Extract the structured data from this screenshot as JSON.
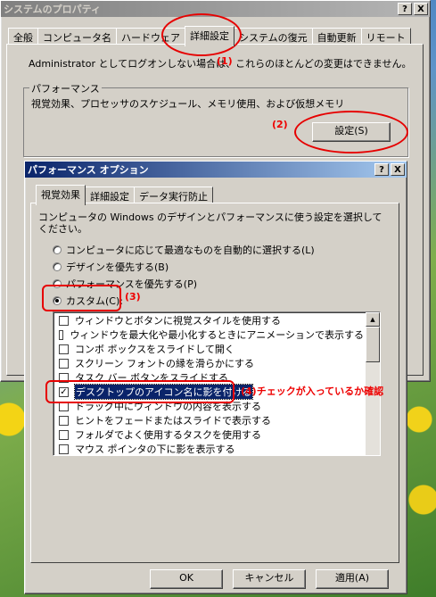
{
  "back_window": {
    "title": "システムのプロパティ",
    "tabs": [
      "全般",
      "コンピュータ名",
      "ハードウェア",
      "詳細設定",
      "システムの復元",
      "自動更新",
      "リモート"
    ],
    "selected_tab": 3,
    "admin_note": "Administrator としてログオンしない場合は、これらのほとんどの変更はできません。",
    "perf_group_label": "パフォーマンス",
    "perf_desc": "視覚効果、プロセッサのスケジュール、メモリ使用、および仮想メモリ",
    "settings_button": "設定(S)"
  },
  "front_window": {
    "title": "パフォーマンス オプション",
    "tabs": [
      "視覚効果",
      "詳細設定",
      "データ実行防止"
    ],
    "selected_tab": 0,
    "description": "コンピュータの Windows のデザインとパフォーマンスに使う設定を選択してください。",
    "radios": [
      {
        "label": "コンピュータに応じて最適なものを自動的に選択する(L)",
        "checked": false
      },
      {
        "label": "デザインを優先する(B)",
        "checked": false
      },
      {
        "label": "パフォーマンスを優先する(P)",
        "checked": false
      },
      {
        "label": "カスタム(C):",
        "checked": true
      }
    ],
    "list_items": [
      {
        "label": "ウィンドウとボタンに視覚スタイルを使用する",
        "checked": false,
        "selected": false
      },
      {
        "label": "ウィンドウを最大化や最小化するときにアニメーションで表示する",
        "checked": false,
        "selected": false
      },
      {
        "label": "コンボ ボックスをスライドして開く",
        "checked": false,
        "selected": false
      },
      {
        "label": "スクリーン フォントの縁を滑らかにする",
        "checked": false,
        "selected": false
      },
      {
        "label": "タスク バー ボタンをスライドする",
        "checked": false,
        "selected": false
      },
      {
        "label": "デスクトップのアイコン名に影を付ける",
        "checked": true,
        "selected": true
      },
      {
        "label": "ドラッグ中にウィンドウの内容を表示する",
        "checked": false,
        "selected": false
      },
      {
        "label": "ヒントをフェードまたはスライドで表示する",
        "checked": false,
        "selected": false
      },
      {
        "label": "フォルダでよく使用するタスクを使用する",
        "checked": false,
        "selected": false
      },
      {
        "label": "マウス ポインタの下に影を表示する",
        "checked": false,
        "selected": false
      }
    ],
    "ok_button": "OK",
    "cancel_button": "キャンセル",
    "apply_button": "適用(A)"
  },
  "title_buttons": {
    "help": "?",
    "close": "X"
  },
  "annotations": {
    "a1": "(1)",
    "a2": "(2)",
    "a3": "(3)",
    "a4": "(4)チェックが入っているか確認"
  },
  "colors": {
    "annotation_red": "#e60000",
    "active_title": "#0a246a",
    "selection": "#0a246a"
  }
}
